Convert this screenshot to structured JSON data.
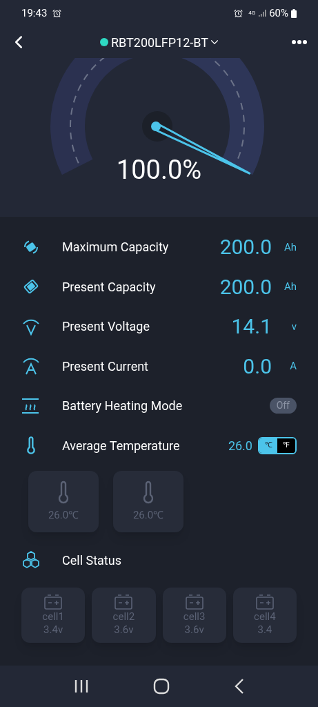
{
  "status_bar": {
    "time": "19:43",
    "network": "4G",
    "battery": "60%"
  },
  "header": {
    "device": "RBT200LFP12-BT",
    "connected": true
  },
  "gauge": {
    "reading": "100.0%"
  },
  "metrics": [
    {
      "kind": "max-capacity",
      "label": "Maximum Capacity",
      "value": "200.0",
      "unit": "Ah"
    },
    {
      "kind": "present-capacity",
      "label": "Present Capacity",
      "value": "200.0",
      "unit": "Ah"
    },
    {
      "kind": "voltage",
      "label": "Present Voltage",
      "value": "14.1",
      "unit": "v"
    },
    {
      "kind": "current",
      "label": "Present Current",
      "value": "0.0",
      "unit": "A"
    }
  ],
  "heating": {
    "label": "Battery Heating Mode",
    "toggle": "Off",
    "on": false
  },
  "temperature": {
    "label": "Average Temperature",
    "value": "26.0",
    "units": [
      {
        "label": "℃",
        "selected": true
      },
      {
        "label": "℉",
        "selected": false
      }
    ],
    "sensors": [
      {
        "reading": "26.0℃"
      },
      {
        "reading": "26.0℃"
      }
    ]
  },
  "cells_section": {
    "label": "Cell Status",
    "cells": [
      {
        "name": "cell1",
        "voltage": "3.4v"
      },
      {
        "name": "cell2",
        "voltage": "3.6v"
      },
      {
        "name": "cell3",
        "voltage": "3.6v"
      },
      {
        "name": "cell4",
        "voltage": "3.4"
      }
    ]
  }
}
